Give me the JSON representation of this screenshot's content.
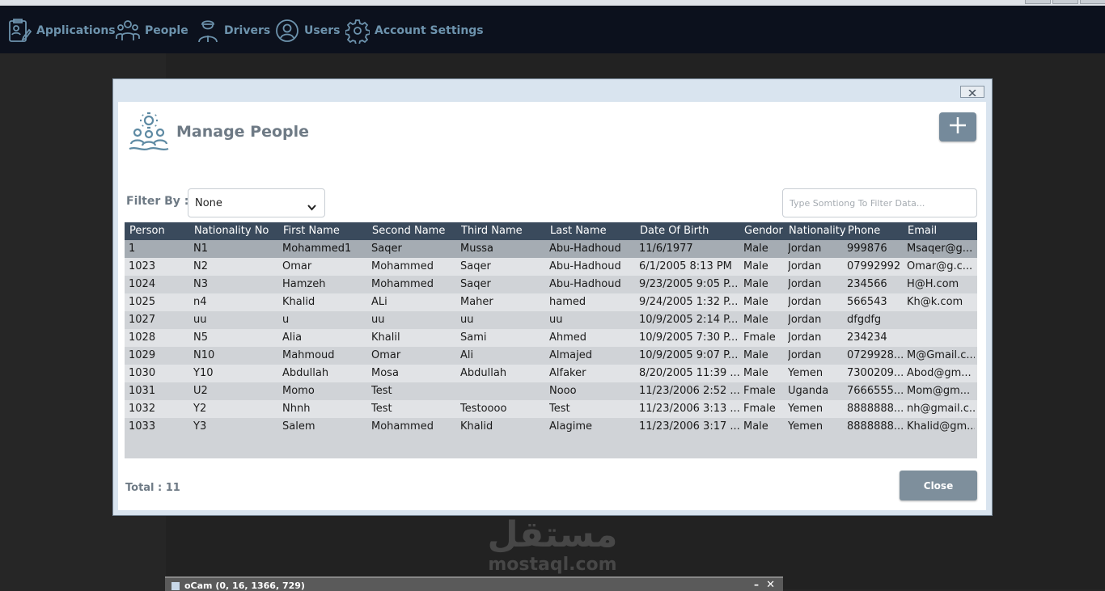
{
  "nav": {
    "items": [
      {
        "label": "Applications",
        "icon": "applications-icon"
      },
      {
        "label": "People",
        "icon": "people-icon"
      },
      {
        "label": "Drivers",
        "icon": "driver-icon"
      },
      {
        "label": "Users",
        "icon": "user-icon"
      },
      {
        "label": "Account Settings",
        "icon": "gear-icon"
      }
    ]
  },
  "dialog": {
    "title": "Manage People",
    "filter_label": "Filter By :",
    "filter_value": "None",
    "search_placeholder": "Type Somtiong To Filter Data...",
    "total_label": "Total : 11",
    "close_label": "Close"
  },
  "table": {
    "columns": [
      "Person",
      "Nationality No",
      "First Name",
      "Second Name",
      "Third Name",
      "Last Name",
      "Date Of Birth",
      "Gendor",
      "Nationality",
      "Phone",
      "Email"
    ],
    "rows": [
      [
        "1",
        "N1",
        "Mohammed1",
        "Saqer",
        "Mussa",
        "Abu-Hadhoud",
        "11/6/1977",
        "Male",
        "Jordan",
        "999876",
        "Msaqer@g..."
      ],
      [
        "1023",
        "N2",
        "Omar",
        "Mohammed",
        "Saqer",
        "Abu-Hadhoud",
        "6/1/2005 8:13 PM",
        "Male",
        "Jordan",
        "07992992",
        "Omar@g.c..."
      ],
      [
        "1024",
        "N3",
        "Hamzeh",
        "Mohammed",
        "Saqer",
        "Abu-Hadhoud",
        "9/23/2005 9:05 P...",
        "Male",
        "Jordan",
        "234566",
        "H@H.com"
      ],
      [
        "1025",
        "n4",
        "Khalid",
        "ALi",
        "Maher",
        "hamed",
        "9/24/2005 1:32 P...",
        "Male",
        "Jordan",
        "566543",
        "Kh@k.com"
      ],
      [
        "1027",
        "uu",
        "u",
        "uu",
        "uu",
        "uu",
        "10/9/2005 2:14 P...",
        "Male",
        "Jordan",
        "dfgdfg",
        ""
      ],
      [
        "1028",
        "N5",
        "Alia",
        "Khalil",
        "Sami",
        "Ahmed",
        "10/9/2005 7:30 P...",
        "Fmale",
        "Jordan",
        "234234",
        ""
      ],
      [
        "1029",
        "N10",
        "Mahmoud",
        "Omar",
        "Ali",
        "Almajed",
        "10/9/2005 9:07 P...",
        "Male",
        "Jordan",
        "0729928...",
        "M@Gmail.c..."
      ],
      [
        "1030",
        "Y10",
        "Abdullah",
        "Mosa",
        "Abdullah",
        "Alfaker",
        "8/20/2005 11:39 ...",
        "Male",
        "Yemen",
        "7300209...",
        "Abod@gm..."
      ],
      [
        "1031",
        "U2",
        "Momo",
        "Test",
        "",
        "Nooo",
        "11/23/2006 2:52 ...",
        "Fmale",
        "Uganda",
        "7666555...",
        "Mom@gm..."
      ],
      [
        "1032",
        "Y2",
        "Nhnh",
        "Test",
        "Testoooo",
        "Test",
        "11/23/2006 3:13 ...",
        "Fmale",
        "Yemen",
        "8888888...",
        "nh@gmail.c..."
      ],
      [
        "1033",
        "Y3",
        "Salem",
        "Mohammed",
        "Khalid",
        "Alagime",
        "11/23/2006 3:17 ...",
        "Male",
        "Yemen",
        "8888888...",
        "Khalid@gm..."
      ]
    ]
  },
  "watermark": {
    "arabic": "مستقل",
    "latin": "mostaql.com"
  },
  "ocam": {
    "title": "oCam (0, 16, 1366, 729)"
  },
  "colors": {
    "nav_bg": "#0c111d",
    "nav_text": "#6d93ad",
    "header_bg": "#3a4a5c",
    "selected_row": "#a5acb3"
  }
}
